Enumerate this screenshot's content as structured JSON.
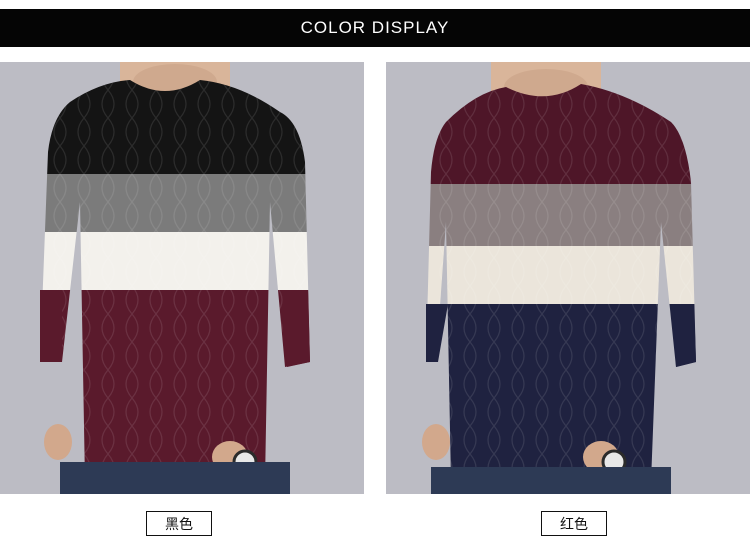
{
  "header": {
    "title": "COLOR DISPLAY"
  },
  "variants": [
    {
      "label": "黑色",
      "stripes": [
        "#141414",
        "#7b7b7b",
        "#f3f1ec",
        "#5a1a2c"
      ],
      "sleeve_lower": "#5a1a2c",
      "background": "#bcbcc4"
    },
    {
      "label": "红色",
      "stripes": [
        "#4e1628",
        "#8a7f80",
        "#ebe5db",
        "#1f2240"
      ],
      "sleeve_lower": "#1f2240",
      "background": "#bcbcc4"
    }
  ]
}
